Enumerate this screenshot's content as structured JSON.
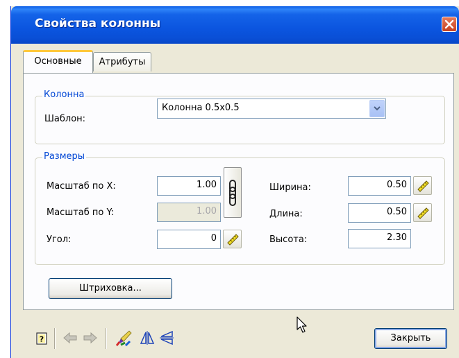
{
  "window": {
    "title": "Свойства колонны"
  },
  "tabs": [
    {
      "label": "Основные",
      "active": true
    },
    {
      "label": "Атрибуты",
      "active": false
    }
  ],
  "column_group": {
    "title": "Колонна",
    "template_label": "Шаблон:",
    "template_value": "Колонна 0.5x0.5"
  },
  "size_group": {
    "title": "Размеры",
    "scale_x_label": "Масштаб по X:",
    "scale_x_value": "1.00",
    "scale_y_label": "Масштаб по Y:",
    "scale_y_value": "1.00",
    "angle_label": "Угол:",
    "angle_value": "0",
    "width_label": "Ширина:",
    "width_value": "0.50",
    "length_label": "Длина:",
    "length_value": "0.50",
    "height_label": "Высота:",
    "height_value": "2.30"
  },
  "hatch_button": "Штриховка...",
  "close_button": "Закрыть",
  "icons": [
    "help-icon",
    "arrow-left-icon",
    "arrow-right-icon",
    "paint-icon",
    "mirror-vertical-icon",
    "mirror-horizontal-icon",
    "chain-link-icon",
    "ruler-icon",
    "dropdown-arrow-icon",
    "close-x-icon",
    "mouse-cursor-icon"
  ],
  "colors": {
    "titlebar": "#0a55df",
    "group_title": "#0046d5",
    "active_tab_accent": "#ffc83c",
    "dialog_bg": "#ece9d8"
  }
}
